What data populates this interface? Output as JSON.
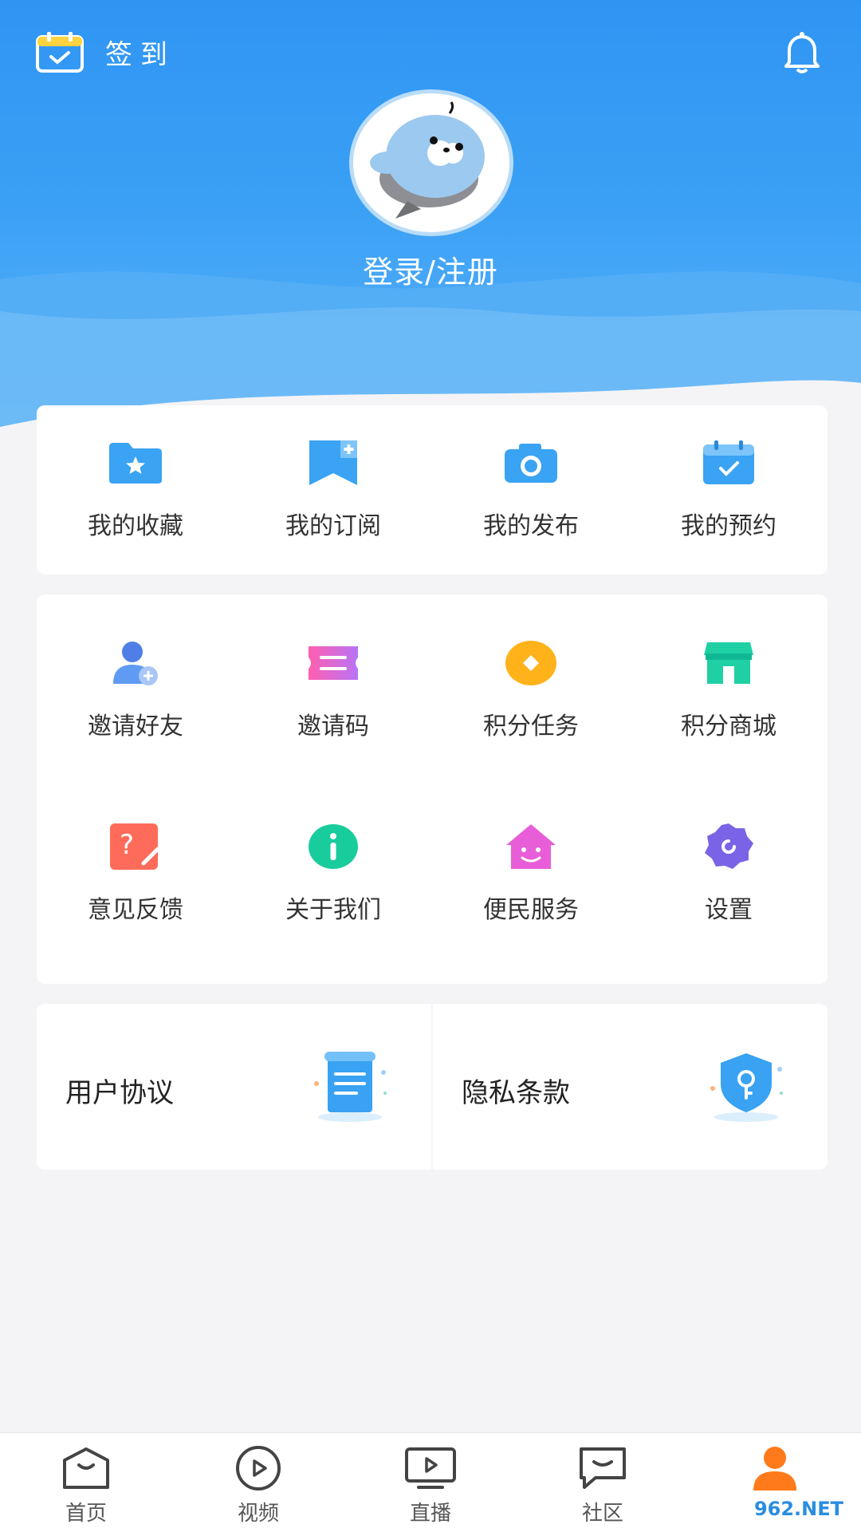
{
  "header": {
    "checkin_label": "签到",
    "login_label": "登录/注册"
  },
  "quick_links": [
    {
      "label": "我的收藏",
      "icon": "favorites-folder-icon"
    },
    {
      "label": "我的订阅",
      "icon": "subscription-icon"
    },
    {
      "label": "我的发布",
      "icon": "camera-icon"
    },
    {
      "label": "我的预约",
      "icon": "calendar-check-icon"
    }
  ],
  "services": [
    {
      "label": "邀请好友",
      "icon": "invite-friend-icon"
    },
    {
      "label": "邀请码",
      "icon": "ticket-icon"
    },
    {
      "label": "积分任务",
      "icon": "coin-icon"
    },
    {
      "label": "积分商城",
      "icon": "store-icon"
    },
    {
      "label": "意见反馈",
      "icon": "feedback-icon"
    },
    {
      "label": "关于我们",
      "icon": "info-icon"
    },
    {
      "label": "便民服务",
      "icon": "home-smile-icon"
    },
    {
      "label": "设置",
      "icon": "settings-gear-icon"
    }
  ],
  "docs": [
    {
      "label": "用户协议",
      "icon": "document-icon"
    },
    {
      "label": "隐私条款",
      "icon": "shield-key-icon"
    }
  ],
  "tabs": [
    {
      "label": "首页",
      "icon": "home-icon"
    },
    {
      "label": "视频",
      "icon": "video-play-icon"
    },
    {
      "label": "直播",
      "icon": "tv-live-icon"
    },
    {
      "label": "社区",
      "icon": "chat-bubble-icon"
    },
    {
      "label": "",
      "icon": "profile-person-icon",
      "active": true
    }
  ],
  "watermark": "962.NET",
  "colors": {
    "header_blue": "#2f95f3",
    "active_tab": "#ff7a1a",
    "background": "#f4f4f6"
  }
}
